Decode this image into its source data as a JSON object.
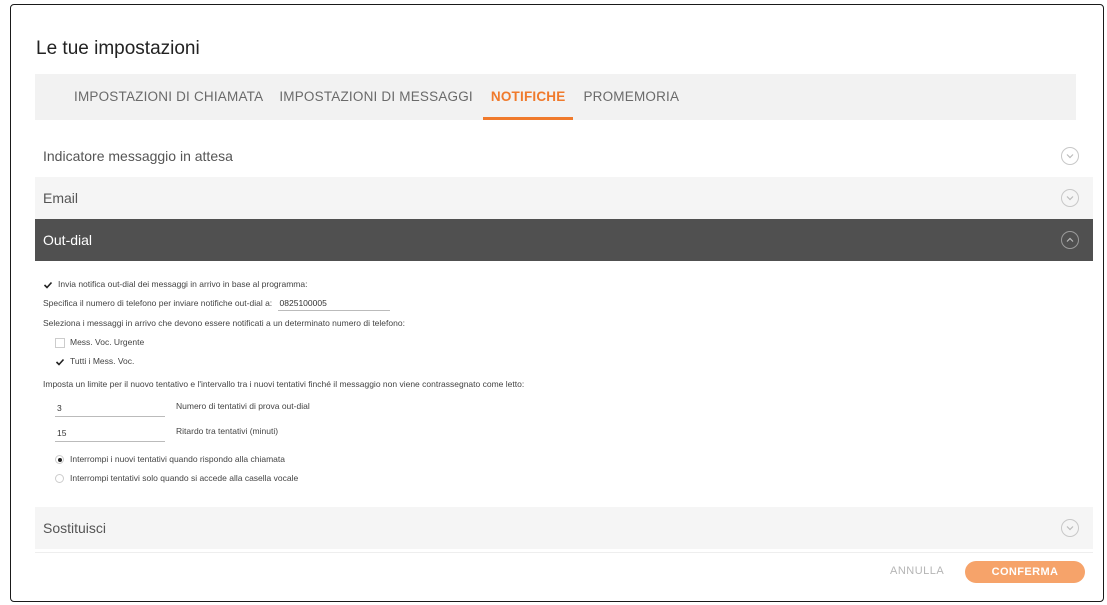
{
  "page": {
    "title": "Le tue impostazioni"
  },
  "tabs": [
    {
      "label": "IMPOSTAZIONI DI CHIAMATA",
      "active": false
    },
    {
      "label": "IMPOSTAZIONI DI MESSAGGI",
      "active": false
    },
    {
      "label": "NOTIFICHE",
      "active": true
    },
    {
      "label": "PROMEMORIA",
      "active": false
    }
  ],
  "sections": {
    "mwi": "Indicatore messaggio in attesa",
    "email": "Email",
    "outdial": "Out-dial",
    "replace": "Sostituisci"
  },
  "outdial": {
    "send_notification": {
      "label": "Invia notifica out-dial dei messaggi in arrivo in base al programma:",
      "checked": true
    },
    "phone_label": "Specifica il numero di telefono per inviare notifiche out-dial a:",
    "phone_value": "0825100005",
    "select_label": "Seleziona i messaggi in arrivo che devono essere notificati a un determinato numero di telefono:",
    "urgent": {
      "label": "Mess. Voc. Urgente",
      "checked": false
    },
    "all": {
      "label": "Tutti i Mess. Voc.",
      "checked": true
    },
    "limit_label": "Imposta un limite per il nuovo tentativo e l'intervallo tra i nuovi tentativi finché il messaggio non viene contrassegnato come letto:",
    "attempts_value": "3",
    "attempts_label": "Numero di tentativi di prova out-dial",
    "delay_value": "15",
    "delay_label": "Ritardo tra tentativi (minuti)",
    "stop_on_answer": {
      "label": "Interrompi i nuovi tentativi quando rispondo alla chiamata",
      "selected": true
    },
    "stop_on_mailbox": {
      "label": "Interrompi tentativi solo quando si accede alla casella vocale",
      "selected": false
    }
  },
  "footer": {
    "cancel": "ANNULLA",
    "confirm": "CONFERMA"
  },
  "colors": {
    "accent": "#f07a2c",
    "dark_header": "#505050",
    "confirm_bg": "#f6a36a"
  }
}
